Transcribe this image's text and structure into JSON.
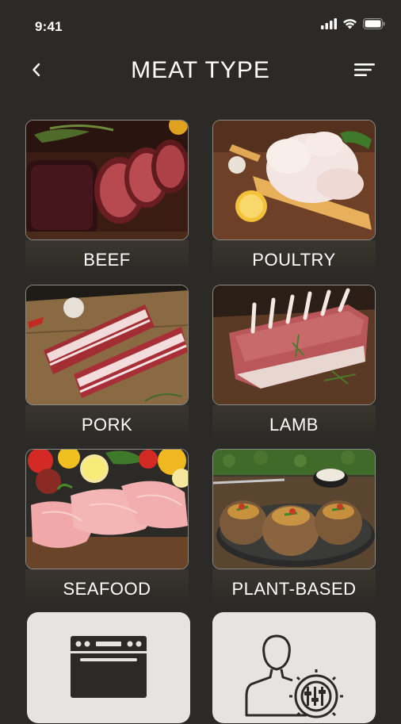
{
  "status": {
    "time": "9:41",
    "icons": [
      "signal-icon",
      "wifi-icon",
      "battery-icon"
    ]
  },
  "header": {
    "title": "MEAT TYPE",
    "back_icon": "chevron-left-icon",
    "menu_icon": "menu-lines-icon"
  },
  "categories": [
    {
      "label": "BEEF"
    },
    {
      "label": "POULTRY"
    },
    {
      "label": "PORK"
    },
    {
      "label": "LAMB"
    },
    {
      "label": "SEAFOOD"
    },
    {
      "label": "PLANT-BASED"
    }
  ],
  "tools": [
    {
      "icon": "oven-icon"
    },
    {
      "icon": "user-settings-icon"
    }
  ],
  "colors": {
    "background": "#2b2a26",
    "tool_card": "#e6e4e0",
    "text": "#ffffff"
  }
}
